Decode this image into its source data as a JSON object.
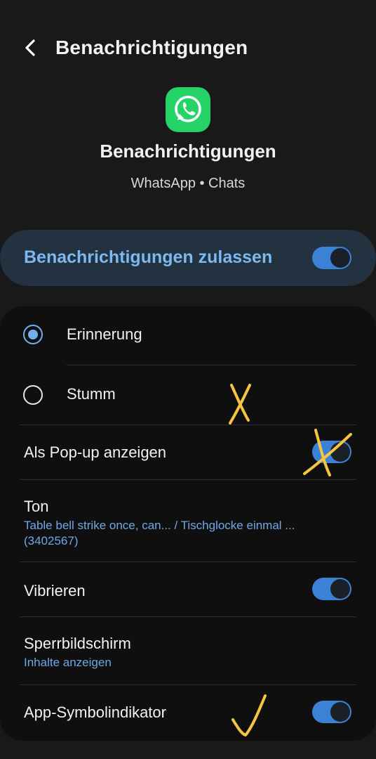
{
  "header": {
    "title": "Benachrichtigungen",
    "back_icon": "chevron-left-icon"
  },
  "app": {
    "icon": "whatsapp-icon",
    "icon_color": "#25d366",
    "title": "Benachrichtigungen",
    "subtitle": "WhatsApp • Chats"
  },
  "allow": {
    "label": "Benachrichtigungen zulassen",
    "enabled": true
  },
  "options": {
    "reminder": {
      "label": "Erinnerung",
      "selected": true
    },
    "silent": {
      "label": "Stumm",
      "selected": false
    },
    "popup": {
      "label": "Als Pop-up anzeigen",
      "enabled": true
    },
    "sound": {
      "label": "Ton",
      "value_line1": "Table bell strike once, can... / Tischglocke einmal ...",
      "value_line2": "(3402567)"
    },
    "vibrate": {
      "label": "Vibrieren",
      "enabled": true
    },
    "lockscreen": {
      "label": "Sperrbildschirm",
      "value": "Inhalte anzeigen"
    },
    "badge": {
      "label": "App-Symbolindikator",
      "enabled": true
    }
  },
  "colors": {
    "accent": "#3b82d6",
    "link": "#6fa8e6",
    "annotation": "#f5c542"
  }
}
